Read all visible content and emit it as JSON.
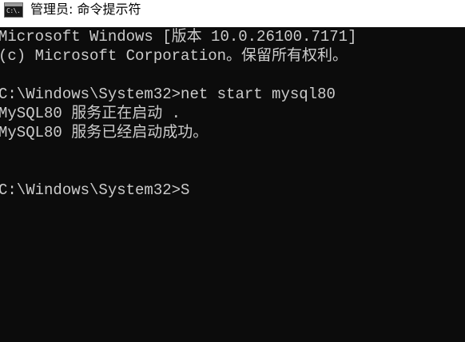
{
  "window": {
    "title": "管理员: 命令提示符",
    "icon_name": "command-prompt-icon",
    "icon_glyph": "C:\\."
  },
  "console": {
    "lines": [
      "Microsoft Windows [版本 10.0.26100.7171]",
      "(c) Microsoft Corporation。保留所有权利。",
      "",
      "C:\\Windows\\System32>net start mysql80",
      "MySQL80 服务正在启动 .",
      "MySQL80 服务已经启动成功。",
      "",
      "",
      "C:\\Windows\\System32>S"
    ]
  },
  "colors": {
    "console_background": "#0c0c0c",
    "console_text": "#cccccc",
    "titlebar_background": "#ffffff"
  }
}
